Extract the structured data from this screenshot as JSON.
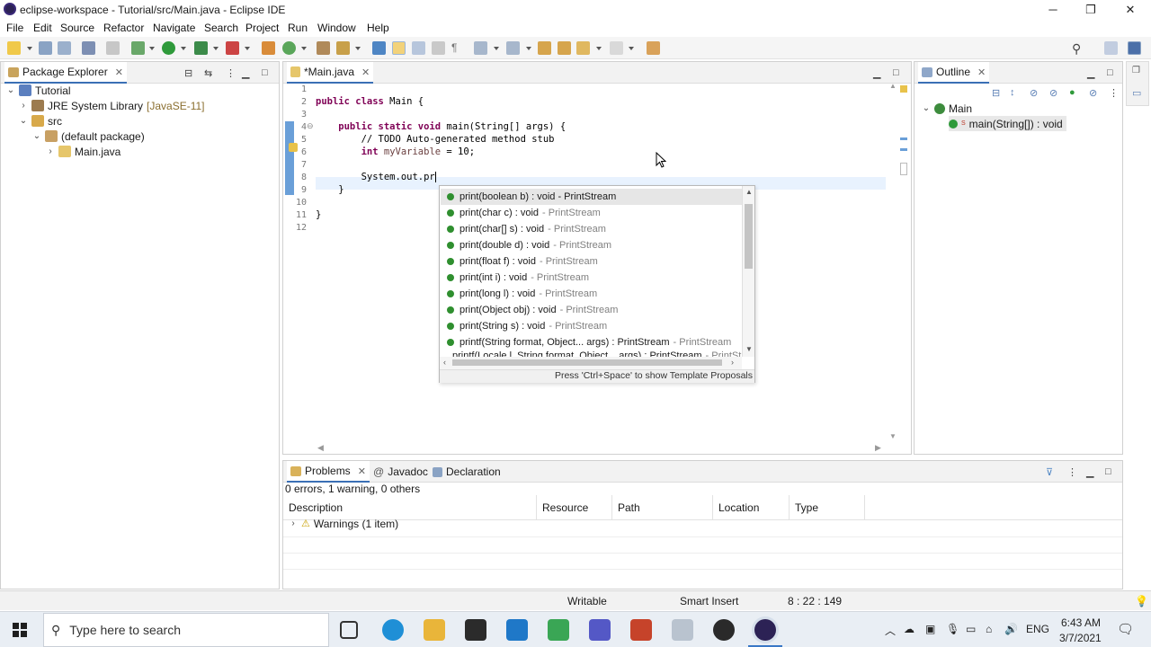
{
  "window": {
    "title": "eclipse-workspace - Tutorial/src/Main.java - Eclipse IDE",
    "minimize": "─",
    "maximize": "❐",
    "close": "✕"
  },
  "menu": [
    "File",
    "Edit",
    "Source",
    "Refactor",
    "Navigate",
    "Search",
    "Project",
    "Run",
    "Window",
    "Help"
  ],
  "package_explorer": {
    "tab": "Package Explorer",
    "tree": [
      {
        "label": "Tutorial"
      },
      {
        "label": "JRE System Library",
        "suffix": "[JavaSE-11]"
      },
      {
        "label": "src"
      },
      {
        "label": "(default package)"
      },
      {
        "label": "Main.java"
      }
    ]
  },
  "editor": {
    "tab": "*Main.java",
    "line_numbers": [
      "1",
      "2",
      "3",
      "4",
      "5",
      "6",
      "7",
      "8",
      "9",
      "10",
      "11",
      "12"
    ],
    "fold_marker": "⊖",
    "code": {
      "l2a": "public class",
      "l2b": " Main {",
      "l4a": "    public static void",
      "l4b": " main(String[] args) {",
      "l5": "        // TODO Auto-generated method stub",
      "l6a": "        int",
      "l6b": " myVariable",
      "l6c": " = 10;",
      "l8": "        System.out.pr",
      "l9": "    }",
      "l11": "}"
    }
  },
  "autocomplete": {
    "items": [
      {
        "main": "print(boolean b) : void - PrintStream",
        "qual": ""
      },
      {
        "main": "print(char c) : void",
        "qual": "- PrintStream"
      },
      {
        "main": "print(char[] s) : void",
        "qual": "- PrintStream"
      },
      {
        "main": "print(double d) : void",
        "qual": "- PrintStream"
      },
      {
        "main": "print(float f) : void",
        "qual": "- PrintStream"
      },
      {
        "main": "print(int i) : void",
        "qual": "- PrintStream"
      },
      {
        "main": "print(long l) : void",
        "qual": "- PrintStream"
      },
      {
        "main": "print(Object obj) : void",
        "qual": "- PrintStream"
      },
      {
        "main": "print(String s) : void",
        "qual": "- PrintStream"
      },
      {
        "main": "printf(String format, Object... args) : PrintStream",
        "qual": "- PrintStream"
      },
      {
        "main": "printf(Locale l, String format, Object... args) : PrintStream",
        "qual": "- PrintStream"
      }
    ],
    "hint": "Press 'Ctrl+Space' to show Template Proposals"
  },
  "outline": {
    "tab": "Outline",
    "class": "Main",
    "method": "main(String[]) : void",
    "static_marker": "S"
  },
  "problems": {
    "tabs": [
      "Problems",
      "Javadoc",
      "Declaration"
    ],
    "summary": "0 errors, 1 warning, 0 others",
    "columns": [
      "Description",
      "Resource",
      "Path",
      "Location",
      "Type"
    ],
    "rows": [
      {
        "description": "Warnings (1 item)"
      }
    ]
  },
  "status": {
    "writable": "Writable",
    "insert_mode": "Smart Insert",
    "position": "8 : 22 : 149"
  },
  "taskbar": {
    "search_placeholder": "Type here to search",
    "time": "6:43 AM",
    "date": "3/7/2021",
    "lang": "ENG"
  }
}
